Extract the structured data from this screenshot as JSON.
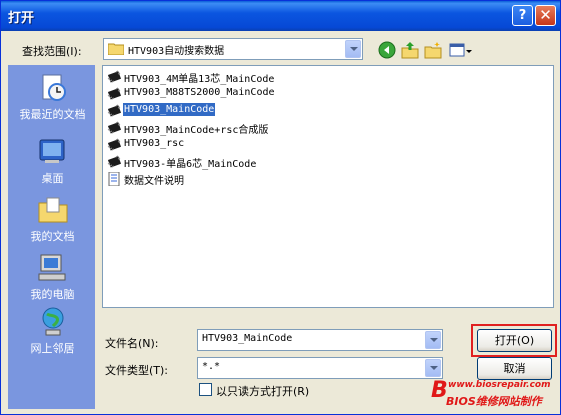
{
  "window": {
    "title": "打开",
    "help_glyph": "?",
    "close_glyph": "✕"
  },
  "lookin": {
    "label": "查找范围(I):",
    "value": "HTV903自动搜索数据",
    "tools": [
      "back-icon",
      "up-folder-icon",
      "new-folder-icon",
      "views-menu-icon"
    ]
  },
  "places": [
    {
      "label": "我最近的文档",
      "icon": "recent-documents-icon"
    },
    {
      "label": "桌面",
      "icon": "desktop-icon"
    },
    {
      "label": "我的文档",
      "icon": "my-documents-icon"
    },
    {
      "label": "我的电脑",
      "icon": "my-computer-icon"
    },
    {
      "label": "网上邻居",
      "icon": "network-places-icon"
    }
  ],
  "files": [
    {
      "name": "HTV903_4M单晶13芯_MainCode",
      "icon": "chip-file-icon",
      "selected": false
    },
    {
      "name": "HTV903_M88TS2000_MainCode",
      "icon": "chip-file-icon",
      "selected": false
    },
    {
      "name": "HTV903_MainCode",
      "icon": "chip-file-icon",
      "selected": true
    },
    {
      "name": "HTV903_MainCode+rsc合成版",
      "icon": "chip-file-icon",
      "selected": false
    },
    {
      "name": "HTV903_rsc",
      "icon": "chip-file-icon",
      "selected": false
    },
    {
      "name": "HTV903-单晶6芯_MainCode",
      "icon": "chip-file-icon",
      "selected": false
    },
    {
      "name": "数据文件说明",
      "icon": "text-document-icon",
      "selected": false
    }
  ],
  "filename": {
    "label": "文件名(N):",
    "value": "HTV903_MainCode"
  },
  "filetype": {
    "label": "文件类型(T):",
    "value": "*.*"
  },
  "readonly": {
    "label": "以只读方式打开(R)",
    "checked": false
  },
  "buttons": {
    "open": "打开(O)",
    "cancel": "取消"
  },
  "watermark": {
    "url": "www.biosrepair.com",
    "brand": "BIOS维修网站制作"
  },
  "colors": {
    "titlebar": "#0054e3",
    "selection": "#316ac5",
    "places_bar": "#7a96df",
    "dialog_bg": "#ece9d8"
  }
}
